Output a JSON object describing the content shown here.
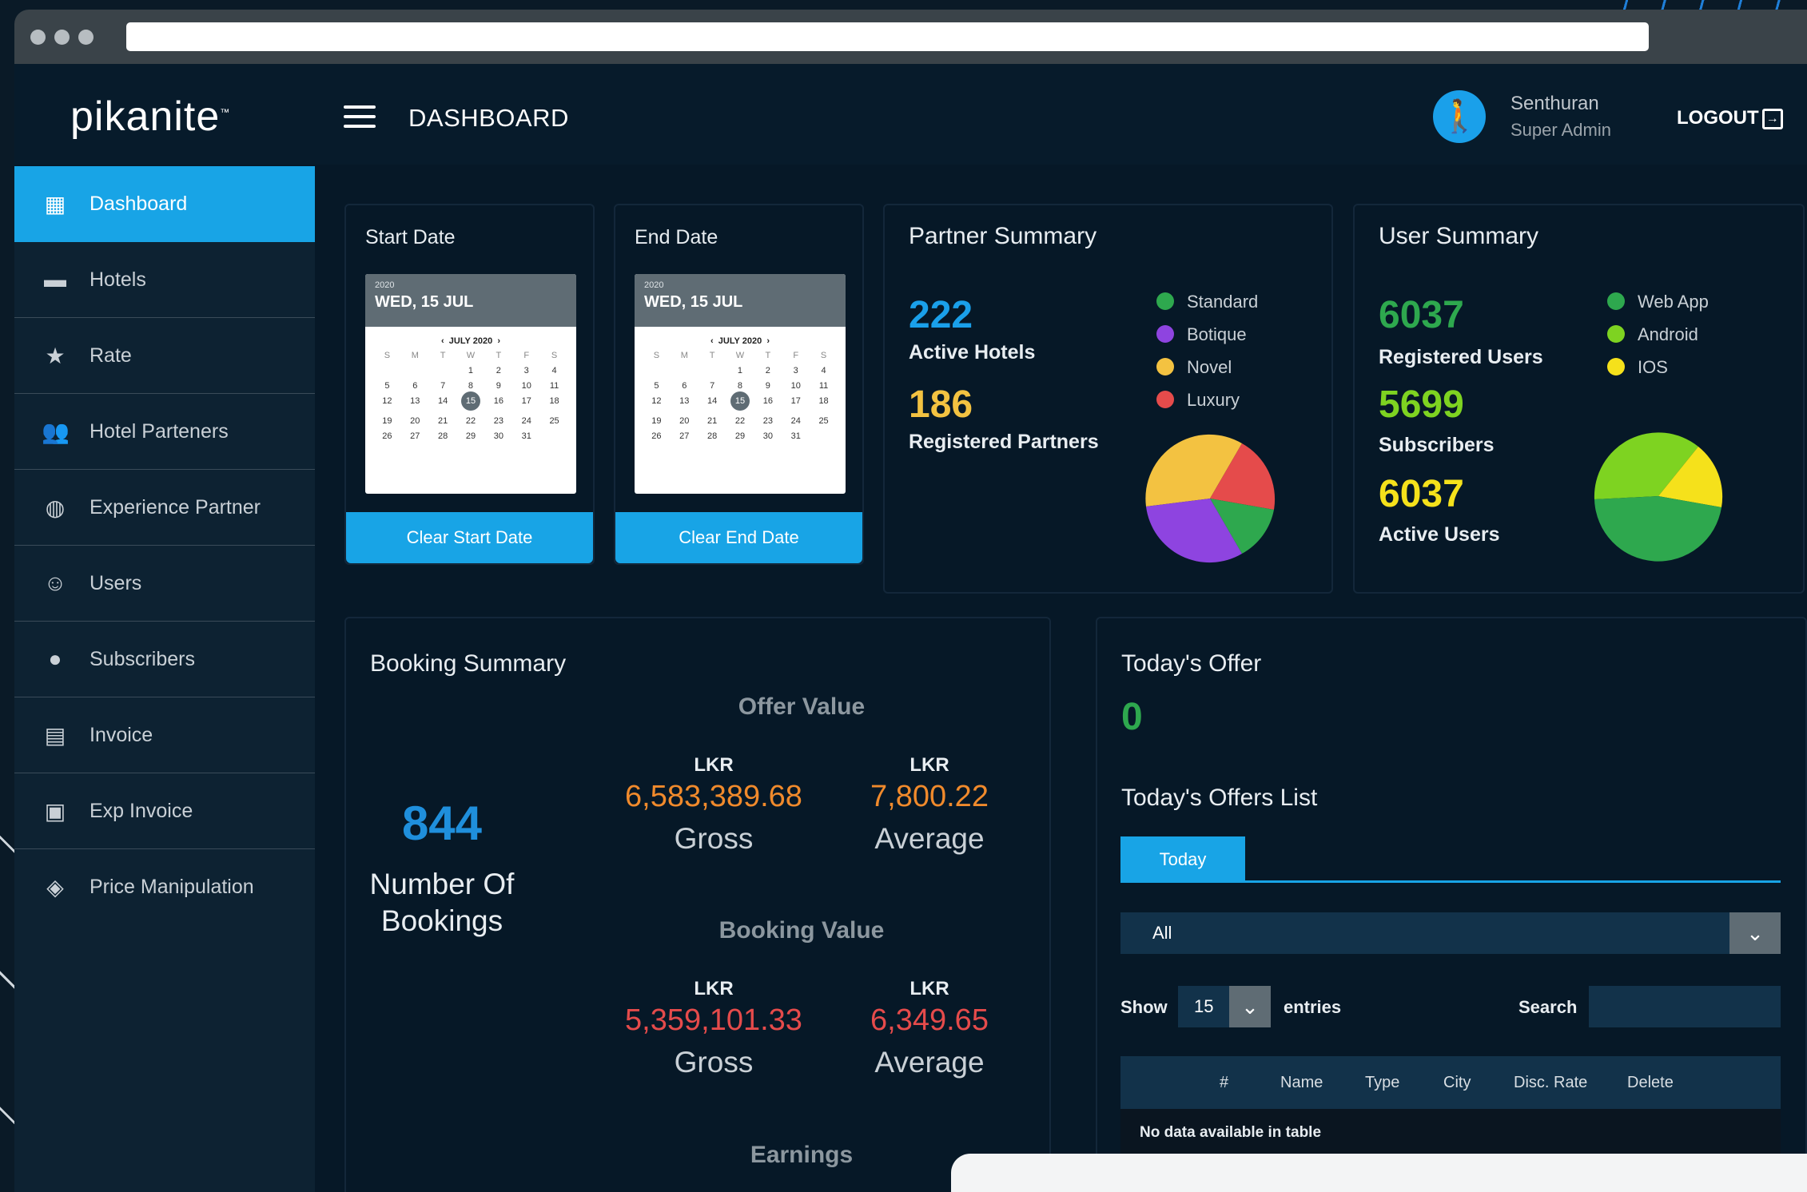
{
  "app": {
    "logo": "pikanite"
  },
  "header": {
    "title": "DASHBOARD",
    "user_name": "Senthuran",
    "user_role": "Super Admin",
    "logout": "LOGOUT"
  },
  "sidebar": {
    "items": [
      {
        "label": "Dashboard",
        "icon": "dashboard-icon"
      },
      {
        "label": "Hotels",
        "icon": "bed-icon"
      },
      {
        "label": "Rate",
        "icon": "star-icon"
      },
      {
        "label": "Hotel Parteners",
        "icon": "people-icon"
      },
      {
        "label": "Experience Partner",
        "icon": "globe-icon"
      },
      {
        "label": "Users",
        "icon": "smile-icon"
      },
      {
        "label": "Subscribers",
        "icon": "person-icon"
      },
      {
        "label": "Invoice",
        "icon": "clipboard-icon"
      },
      {
        "label": "Exp Invoice",
        "icon": "clipboard-alert-icon"
      },
      {
        "label": "Price Manipulation",
        "icon": "tag-icon"
      }
    ]
  },
  "start_date": {
    "title": "Start Date",
    "year": "2020",
    "date": "WED, 15 JUL",
    "month": "JULY 2020",
    "button": "Clear Start Date"
  },
  "end_date": {
    "title": "End Date",
    "year": "2020",
    "date": "WED, 15 JUL",
    "month": "JULY 2020",
    "button": "Clear End Date"
  },
  "calendar": {
    "dow": [
      "S",
      "M",
      "T",
      "W",
      "T",
      "F",
      "S"
    ],
    "days": [
      "",
      "",
      "",
      "1",
      "2",
      "3",
      "4",
      "5",
      "6",
      "7",
      "8",
      "9",
      "10",
      "11",
      "12",
      "13",
      "14",
      "15",
      "16",
      "17",
      "18",
      "19",
      "20",
      "21",
      "22",
      "23",
      "24",
      "25",
      "26",
      "27",
      "28",
      "29",
      "30",
      "31"
    ],
    "selected": "15"
  },
  "partner_summary": {
    "title": "Partner Summary",
    "active_hotels": "222",
    "active_hotels_label": "Active Hotels",
    "registered_partners": "186",
    "registered_partners_label": "Registered Partners",
    "legend": [
      {
        "label": "Standard",
        "color": "#2ea84e"
      },
      {
        "label": "Botique",
        "color": "#8e44e0"
      },
      {
        "label": "Novel",
        "color": "#f3c241"
      },
      {
        "label": "Luxury",
        "color": "#e54b4b"
      }
    ]
  },
  "user_summary": {
    "title": "User Summary",
    "registered_users": "6037",
    "registered_users_label": "Registered Users",
    "subscribers": "5699",
    "subscribers_label": "Subscribers",
    "active_users": "6037",
    "active_users_label": "Active Users",
    "legend": [
      {
        "label": "Web App",
        "color": "#2ea84e"
      },
      {
        "label": "Android",
        "color": "#7ed321"
      },
      {
        "label": "IOS",
        "color": "#f5e11b"
      }
    ]
  },
  "booking_summary": {
    "title": "Booking Summary",
    "bookings": "844",
    "bookings_label_1": "Number Of",
    "bookings_label_2": "Bookings",
    "offer_value_title": "Offer Value",
    "offer_gross_currency": "LKR",
    "offer_gross": "6,583,389.68",
    "offer_gross_label": "Gross",
    "offer_avg_currency": "LKR",
    "offer_avg": "7,800.22",
    "offer_avg_label": "Average",
    "booking_value_title": "Booking Value",
    "booking_gross_currency": "LKR",
    "booking_gross": "5,359,101.33",
    "booking_gross_label": "Gross",
    "booking_avg_currency": "LKR",
    "booking_avg": "6,349.65",
    "booking_avg_label": "Average",
    "earnings_title": "Earnings"
  },
  "todays_offer": {
    "title": "Today's Offer",
    "count": "0",
    "list_title": "Today's Offers List",
    "tab": "Today",
    "filter": "All",
    "show": "Show",
    "entries_value": "15",
    "entries": "entries",
    "search": "Search",
    "columns": [
      "#",
      "Name",
      "Type",
      "City",
      "Disc. Rate",
      "Delete"
    ],
    "empty": "No data available in table"
  }
}
